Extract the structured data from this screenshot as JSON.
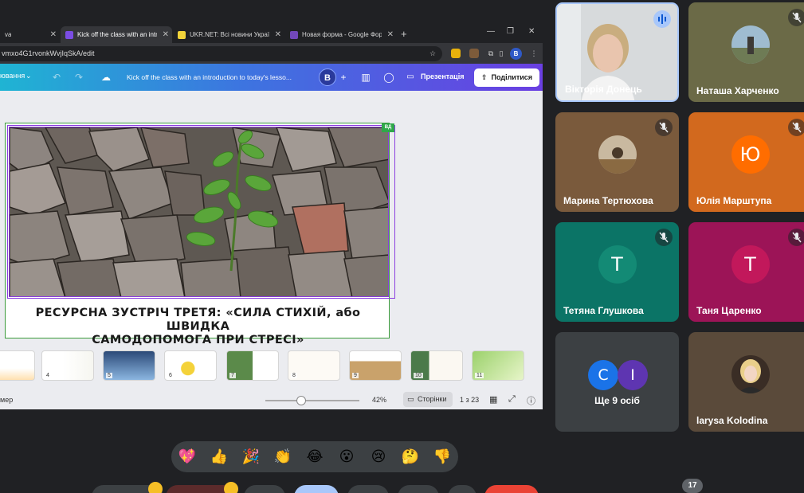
{
  "browser": {
    "tabs": [
      {
        "title": "va",
        "active": false
      },
      {
        "title": "Kick off the class with an introd",
        "active": true
      },
      {
        "title": "UKR.NET: Всі новини України, ",
        "active": false
      },
      {
        "title": "Новая форма - Google Формы",
        "active": false
      }
    ],
    "url": "vmxo4G1rvonkWvjIqSkA/edit",
    "profile_initial": "B"
  },
  "canva": {
    "menu_label": "ювання",
    "doc_title": "Kick off the class with an introduction to today's lesso...",
    "avatar_initial": "B",
    "present_label": "Презентація",
    "share_label": "Поділитися",
    "badge": "ВД"
  },
  "slide": {
    "title_line1": "РЕСУРСНА ЗУСТРІЧ ТРЕТЯ: «СИЛА СТИХІЙ, або ШВИДКА",
    "title_line2": "САМОДОПОМОГА ПРИ СТРЕСІ»"
  },
  "thumbnails": [
    "",
    "4",
    "5",
    "6",
    "7",
    "8",
    "9",
    "10",
    "11"
  ],
  "editor_footer": {
    "notes_label": "мер",
    "zoom": "42%",
    "pages_label": "Сторінки",
    "page_count": "1 з 23"
  },
  "participants": [
    {
      "name": "Вікторія Донець",
      "type": "video",
      "speaking": true
    },
    {
      "name": "Наташа Харченко",
      "type": "photo",
      "muted": true,
      "bg": "#6b6a47"
    },
    {
      "name": "Марина Тертюхова",
      "type": "photo",
      "muted": true,
      "bg": "#7a5a3c"
    },
    {
      "name": "Юлія Марштупа",
      "type": "initial",
      "initial": "Ю",
      "muted": true,
      "bg": "#d2691e",
      "avatar_bg": "#ff6d00"
    },
    {
      "name": "Тетяна Глушкова",
      "type": "initial",
      "initial": "Т",
      "muted": true,
      "bg": "#0b7466",
      "avatar_bg": "#138a75"
    },
    {
      "name": "Таня Царенко",
      "type": "initial",
      "initial": "Т",
      "muted": true,
      "bg": "#9c1457",
      "avatar_bg": "#c2185b"
    },
    {
      "name": "Ще 9 осіб",
      "type": "more",
      "initials": [
        "С",
        "І"
      ],
      "bg": "#3c4043"
    },
    {
      "name": "larysa Kolodina",
      "type": "photo",
      "bg": "#5a4a3a"
    }
  ],
  "reactions": [
    "💖",
    "👍",
    "🎉",
    "👏",
    "😂",
    "😮",
    "😢",
    "🤔",
    "👎"
  ],
  "participant_count": "17"
}
